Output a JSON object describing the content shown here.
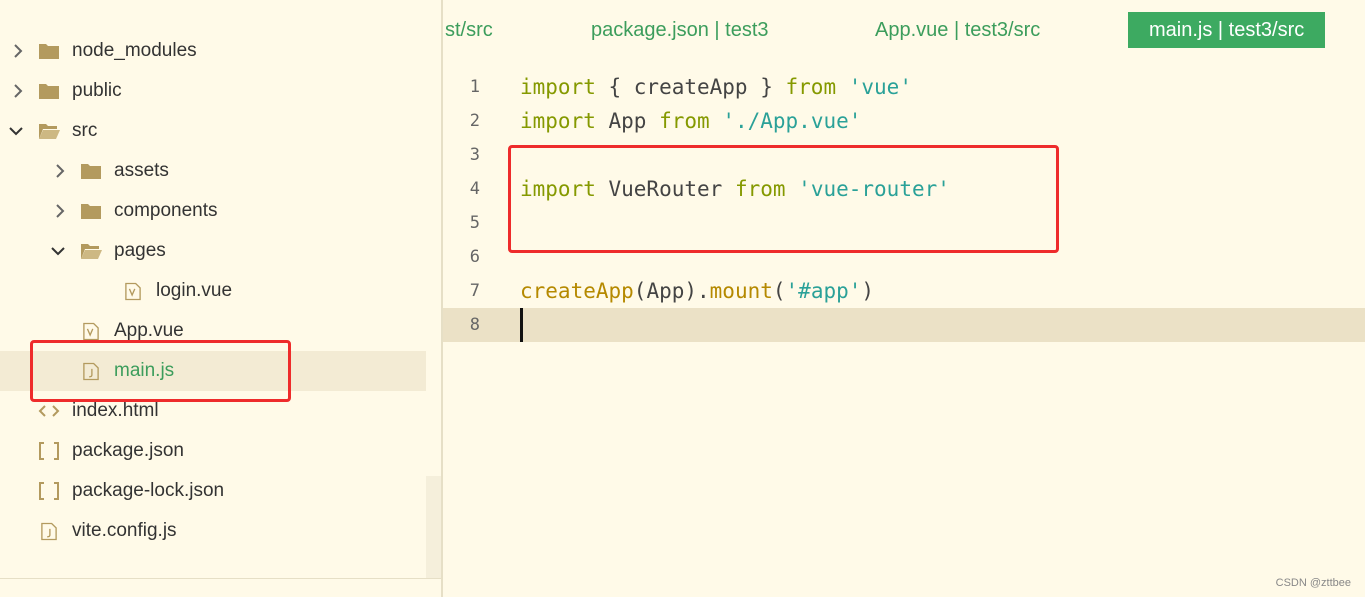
{
  "sidebar": {
    "items": [
      {
        "label": "node_modules",
        "chevron": "right",
        "icon": "folder-closed"
      },
      {
        "label": "public",
        "chevron": "right",
        "icon": "folder-closed"
      },
      {
        "label": "src",
        "chevron": "down",
        "icon": "folder-open"
      },
      {
        "label": "assets",
        "chevron": "right",
        "icon": "folder-closed"
      },
      {
        "label": "components",
        "chevron": "right",
        "icon": "folder-closed"
      },
      {
        "label": "pages",
        "chevron": "down",
        "icon": "folder-open"
      },
      {
        "label": "login.vue",
        "chevron": "",
        "icon": "vue-file"
      },
      {
        "label": "App.vue",
        "chevron": "",
        "icon": "vue-file"
      },
      {
        "label": "main.js",
        "chevron": "",
        "icon": "js-file",
        "selected": true
      },
      {
        "label": "index.html",
        "chevron": "",
        "icon": "html-file"
      },
      {
        "label": "package.json",
        "chevron": "",
        "icon": "json-file"
      },
      {
        "label": "package-lock.json",
        "chevron": "",
        "icon": "json-file"
      },
      {
        "label": "vite.config.js",
        "chevron": "",
        "icon": "js-file"
      }
    ]
  },
  "tabs": [
    {
      "label": "st/src",
      "active": false
    },
    {
      "label": "package.json | test3",
      "active": false
    },
    {
      "label": "App.vue | test3/src",
      "active": false
    },
    {
      "label": "main.js | test3/src",
      "active": true
    }
  ],
  "editor": {
    "lines": [
      {
        "number": "1",
        "tokens": [
          [
            "kw",
            "import"
          ],
          [
            "p",
            " { createApp } "
          ],
          [
            "kw",
            "from"
          ],
          [
            "p",
            " "
          ],
          [
            "str",
            "'vue'"
          ]
        ]
      },
      {
        "number": "2",
        "tokens": [
          [
            "kw",
            "import"
          ],
          [
            "p",
            " App "
          ],
          [
            "kw",
            "from"
          ],
          [
            "p",
            " "
          ],
          [
            "str",
            "'./App.vue'"
          ]
        ]
      },
      {
        "number": "3",
        "tokens": []
      },
      {
        "number": "4",
        "tokens": [
          [
            "kw",
            "import"
          ],
          [
            "p",
            " VueRouter "
          ],
          [
            "kw",
            "from"
          ],
          [
            "p",
            " "
          ],
          [
            "str",
            "'vue-router'"
          ]
        ]
      },
      {
        "number": "5",
        "tokens": []
      },
      {
        "number": "6",
        "tokens": []
      },
      {
        "number": "7",
        "tokens": [
          [
            "fn",
            "createApp"
          ],
          [
            "p",
            "(App)."
          ],
          [
            "fn",
            "mount"
          ],
          [
            "p",
            "("
          ],
          [
            "str",
            "'#app'"
          ],
          [
            "p",
            ")"
          ]
        ]
      },
      {
        "number": "8",
        "tokens": [],
        "current": true
      }
    ]
  },
  "watermark": "CSDN @zttbee",
  "colors": {
    "background": "#fffae8",
    "accent": "#3daa61",
    "keyword": "#859900",
    "string": "#2aa198",
    "function": "#b58900",
    "highlight_box": "#ee2b2b"
  }
}
